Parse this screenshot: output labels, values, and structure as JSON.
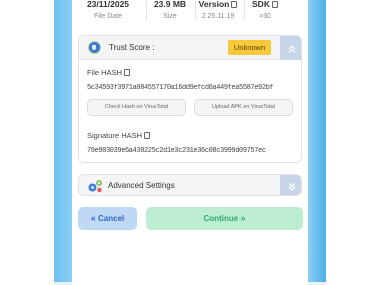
{
  "stats": [
    {
      "value": "23/11/2025",
      "label": "File Date"
    },
    {
      "value": "23.9 MB",
      "label": "Size"
    },
    {
      "value": "Version",
      "label": "2.25.11.19"
    },
    {
      "value": "SDK",
      "label": ">30"
    }
  ],
  "trust": {
    "title": "Trust Score :",
    "status": "Unknown",
    "status_color": "#f7c93a",
    "collapse_icon": "double-chevron-up-icon"
  },
  "file_hash": {
    "label": "File HASH",
    "value": "5c34593f3971a084557170a16dd9efcd0a449fea5587e92bf",
    "check_button": "Check Hash on VirusTotal",
    "upload_button": "Upload APK on VirusTotal"
  },
  "signature_hash": {
    "label": "Signature HASH",
    "value": "79e903039e6a438225c2d1e3c231e36c08c3999d09757ec"
  },
  "advanced": {
    "title": "Advanced Settings",
    "expand_icon": "double-chevron-down-icon"
  },
  "actions": {
    "cancel_label": "Cancel",
    "continue_label": "Continue"
  },
  "colors": {
    "accent_blue": "#4aaee8",
    "cancel_text": "#2f68c9",
    "continue_text": "#33a86a"
  }
}
